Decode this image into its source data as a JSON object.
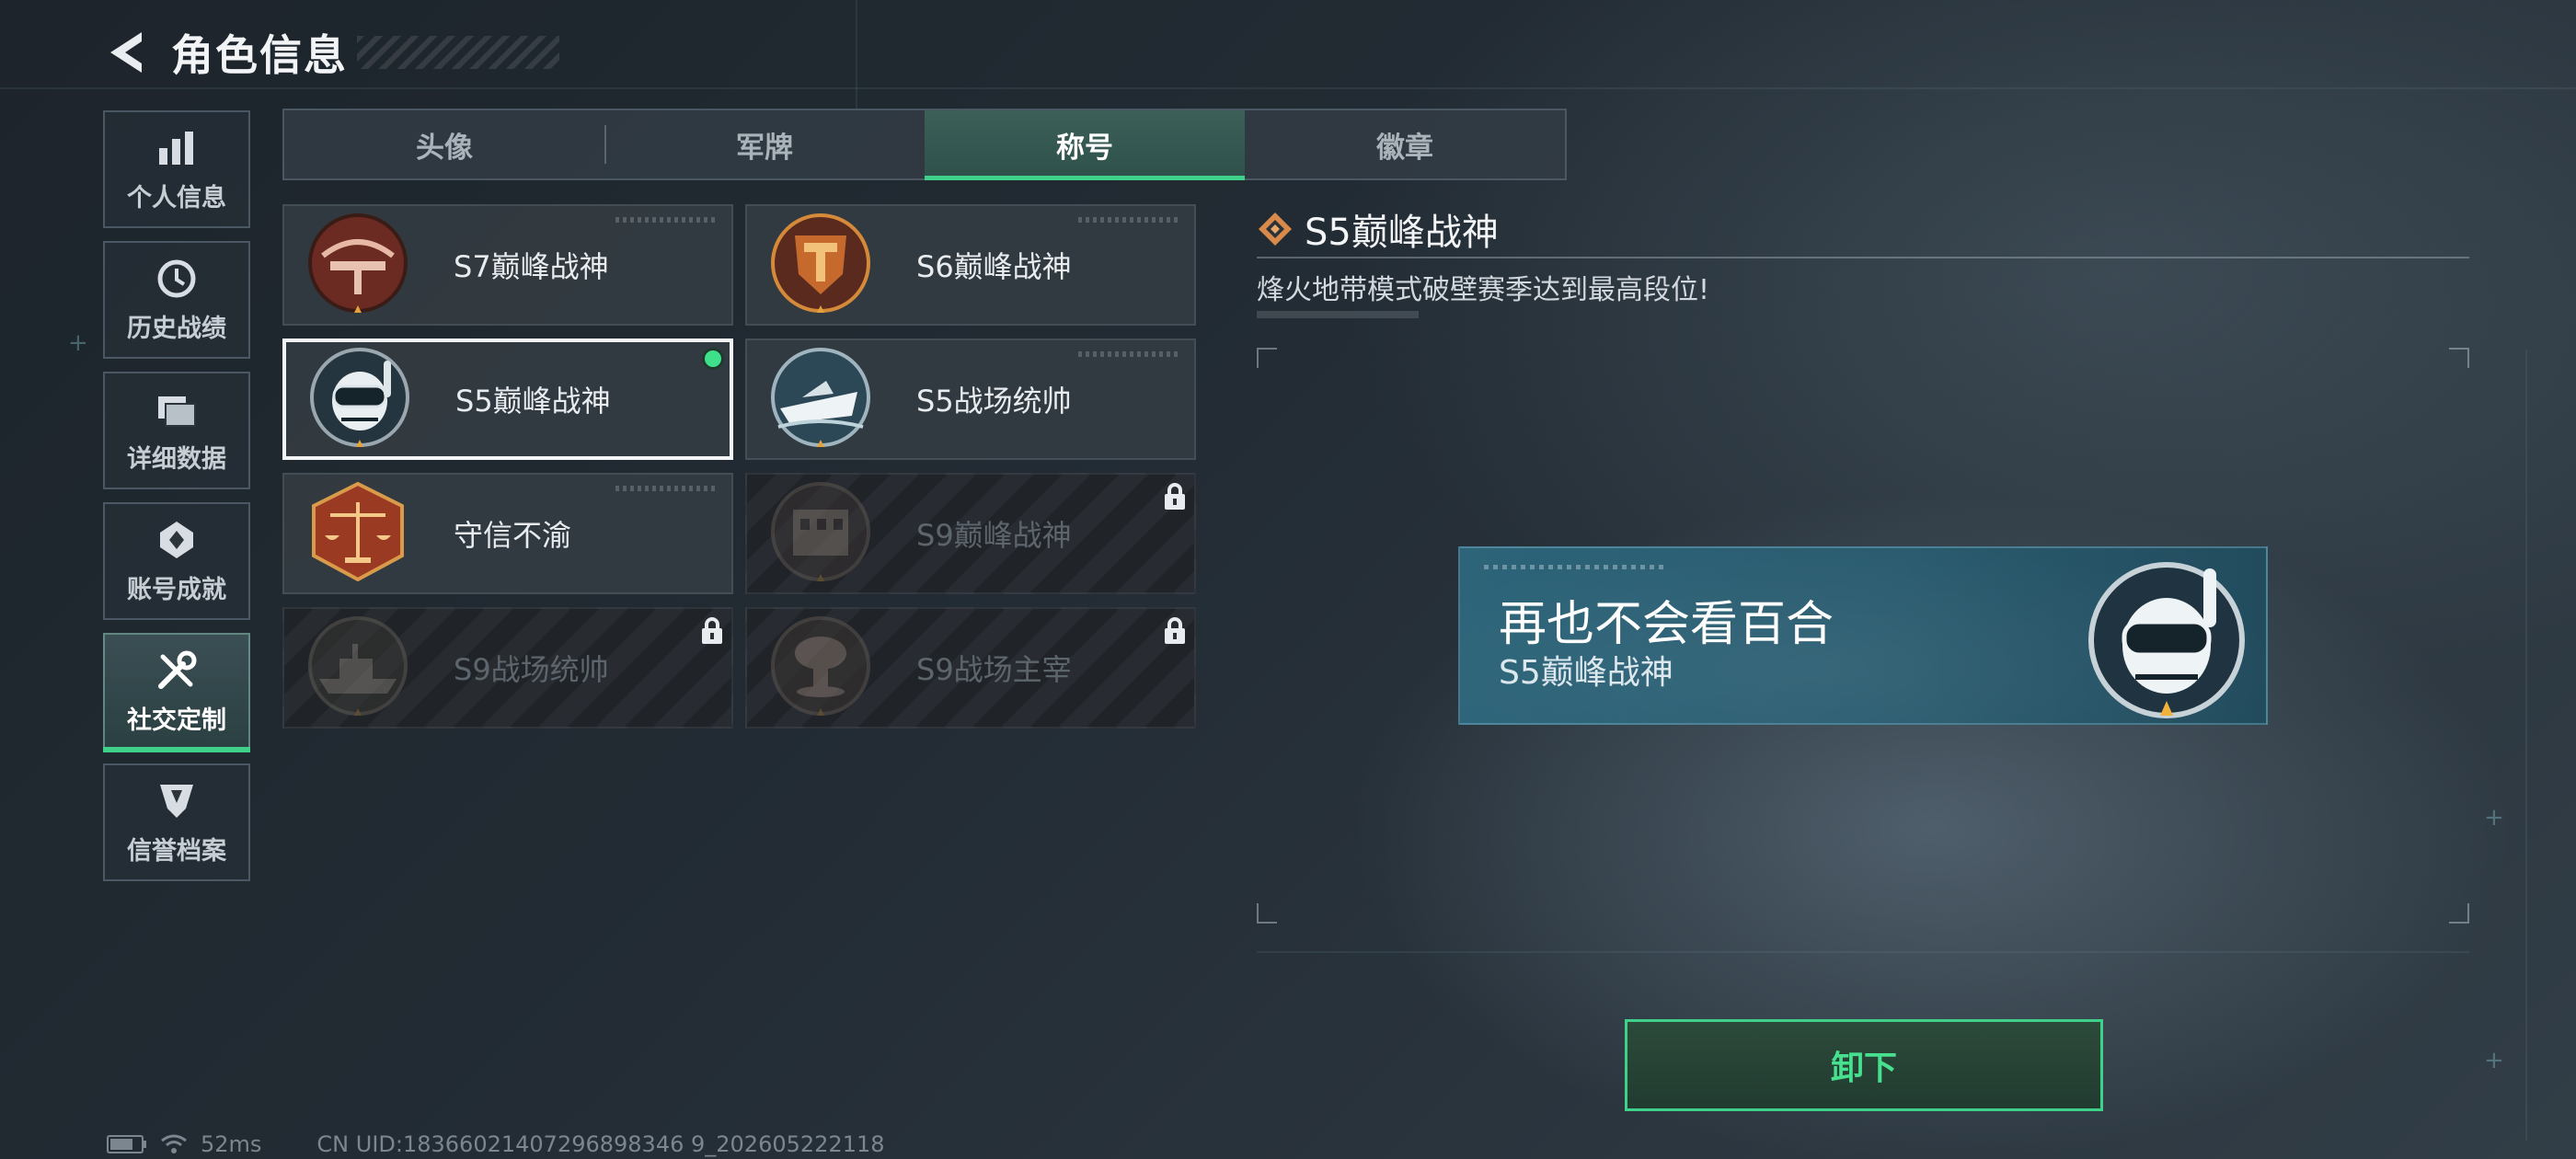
{
  "header": {
    "title": "角色信息"
  },
  "sidebar": {
    "items": [
      {
        "label": "个人信息",
        "icon": "bar-chart-icon",
        "active": false
      },
      {
        "label": "历史战绩",
        "icon": "history-clock-icon",
        "active": false
      },
      {
        "label": "详细数据",
        "icon": "folder-icon",
        "active": false
      },
      {
        "label": "账号成就",
        "icon": "achievement-icon",
        "active": false
      },
      {
        "label": "社交定制",
        "icon": "wrench-screwdriver-icon",
        "active": true
      },
      {
        "label": "信誉档案",
        "icon": "reputation-shield-icon",
        "active": false
      }
    ]
  },
  "tabs": [
    {
      "label": "头像",
      "active": false
    },
    {
      "label": "军牌",
      "active": false
    },
    {
      "label": "称号",
      "active": true
    },
    {
      "label": "徽章",
      "active": false
    }
  ],
  "titles": [
    {
      "name": "S7巅峰战神",
      "icon": "crossbow-badge-icon",
      "locked": false,
      "selected": false,
      "equipped": false
    },
    {
      "name": "S6巅峰战神",
      "icon": "shield-t-badge-icon",
      "locked": false,
      "selected": false,
      "equipped": false
    },
    {
      "name": "S5巅峰战神",
      "icon": "diver-skull-badge-icon",
      "locked": false,
      "selected": true,
      "equipped": true
    },
    {
      "name": "S5战场统帅",
      "icon": "speedboat-badge-icon",
      "locked": false,
      "selected": false,
      "equipped": false
    },
    {
      "name": "守信不渝",
      "icon": "scales-badge-icon",
      "locked": false,
      "selected": false,
      "equipped": false
    },
    {
      "name": "S9巅峰战神",
      "icon": "building-badge-icon",
      "locked": true,
      "selected": false,
      "equipped": false
    },
    {
      "name": "S9战场统帅",
      "icon": "warship-badge-icon",
      "locked": true,
      "selected": false,
      "equipped": false
    },
    {
      "name": "S9战场主宰",
      "icon": "mushroom-cloud-badge-icon",
      "locked": true,
      "selected": false,
      "equipped": false
    }
  ],
  "detail": {
    "title": "S5巅峰战神",
    "description": "烽火地带模式破壁赛季达到最高段位!",
    "nameplate": {
      "player_name": "再也不会看百合",
      "title": "S5巅峰战神"
    },
    "unequip_label": "卸下"
  },
  "status": {
    "ping": "52ms",
    "uid": "CN UID:18366021407296898346 9_202605222118"
  },
  "colors": {
    "accent": "#3fd08a",
    "selected_border": "#f2f4f6",
    "nameplate_bg": "#2d6479"
  }
}
